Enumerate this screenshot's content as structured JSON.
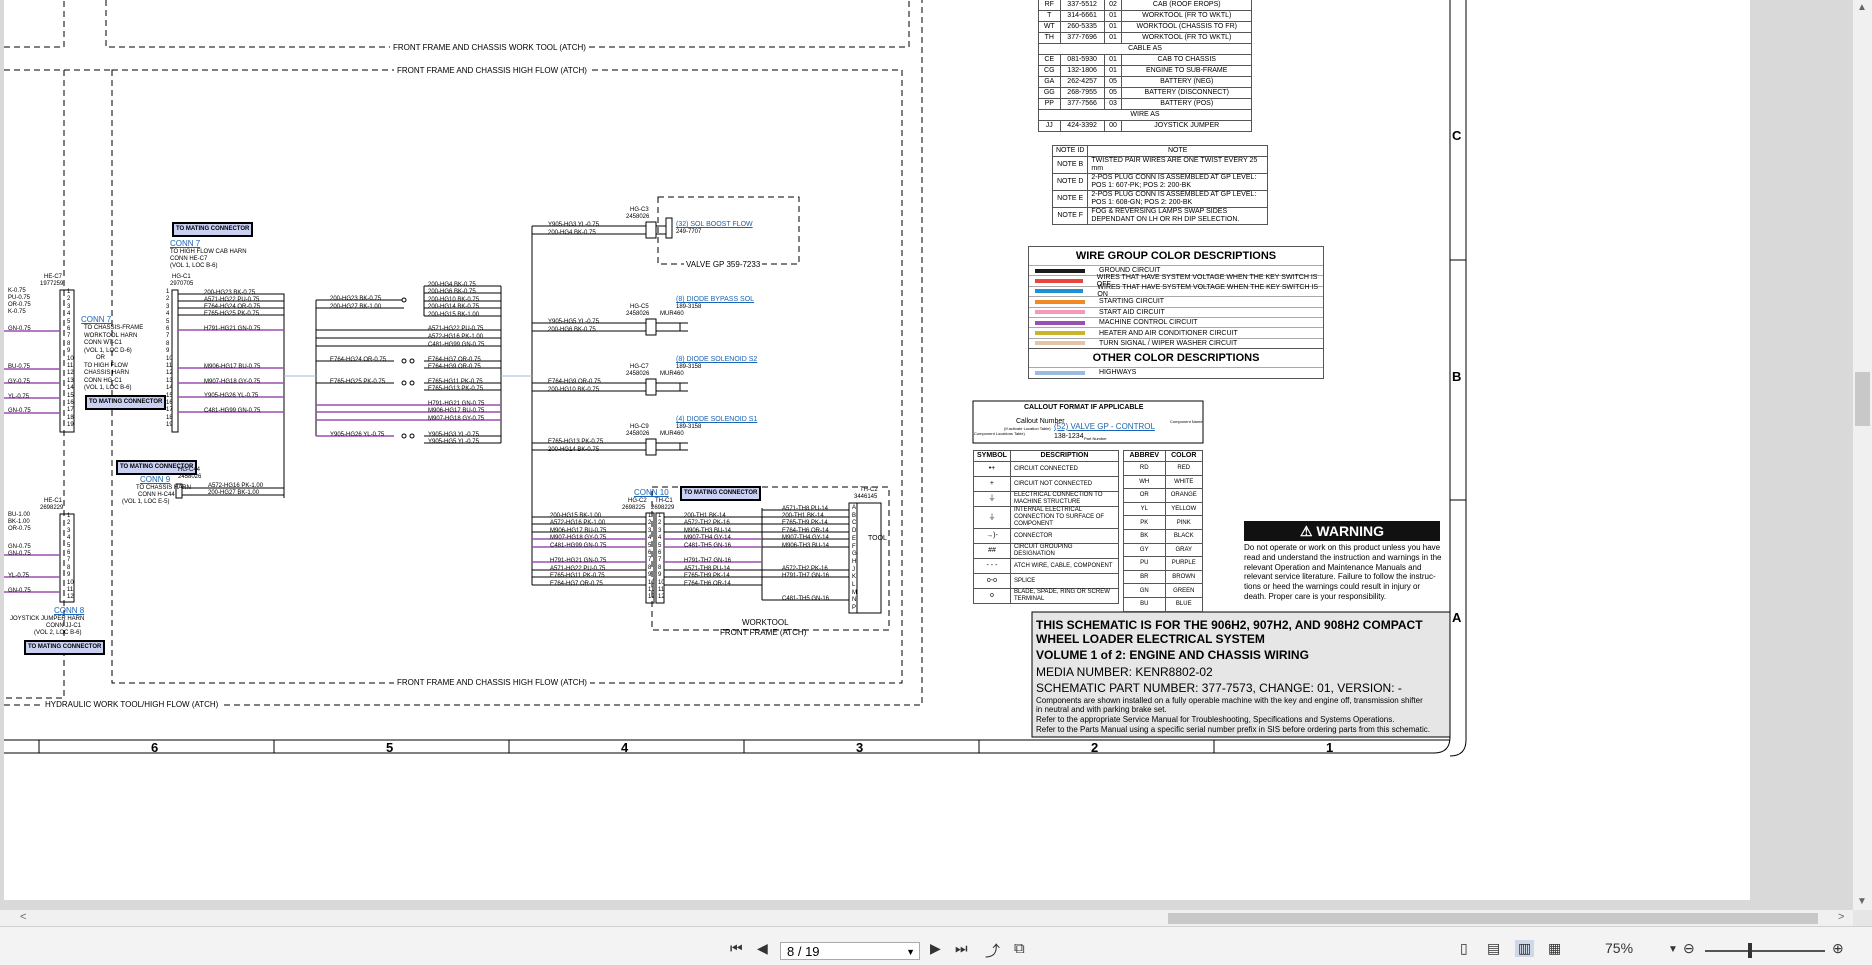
{
  "frames": {
    "work_tool": "FRONT FRAME AND CHASSIS WORK TOOL (ATCH)",
    "high_flow_top": "FRONT FRAME AND CHASSIS HIGH FLOW (ATCH)",
    "high_flow_bottom": "FRONT FRAME AND CHASSIS HIGH FLOW (ATCH)",
    "hydraulic": "HYDRAULIC WORK TOOL/HIGH FLOW (ATCH)"
  },
  "mating": "TO MATING CONNECTOR",
  "conn7a": {
    "title": "CONN 7",
    "l1": "TO HIGH FLOW CAB HARN",
    "l2": "CONN HE-C7",
    "l3": "(VOL 1, LOC B-6)",
    "hg": "HG-C1",
    "pn": "2970705"
  },
  "conn7b": {
    "title": "CONN 7",
    "lines": [
      "TO CHASSIS-FRAME",
      "WORKTOOL HARN",
      "CONN WT-C1",
      "(VOL 1, LOC D-6)",
      "OR",
      "TO HIGH FLOW",
      "CHASSIS HARN",
      "CONN HG-C1",
      "(VOL 1, LOC B-6)"
    ]
  },
  "hec7": {
    "id": "HE-C7",
    "pn": "1977259"
  },
  "hec1": {
    "id": "HE-C1",
    "pn": "2698229"
  },
  "conn9": {
    "title": "CONN 9",
    "l1": "TO CHASSIS HARN",
    "l2": "CONN H-C44",
    "l3": "(VOL 1, LOC E-5)",
    "hg": "HG-C44",
    "pn": "2458026"
  },
  "conn8": {
    "title": "CONN 8",
    "l1": "JOYSTICK JUMPER HARN",
    "l2": "CONN JJ-C1",
    "l3": "(VOL 2, LOC B-6)"
  },
  "conn10": {
    "title": "CONN 10",
    "hgc2": "HG-C2",
    "hgc2pn": "2698225",
    "thc1": "TH-C1",
    "thc1pn": "2698229",
    "thc2": "TH-C2",
    "thc2pn": "3446145",
    "tool": "TOOL",
    "wt1": "WORKTOOL",
    "wt2": "FRONT FRAME (ATCH)"
  },
  "left_wires_top": [
    "K-0.75",
    "PU-0.75",
    "OR-0.75",
    "K-0.75",
    "GN-0.75",
    "BU-0.75",
    "GY-0.75",
    "YL-0.75",
    "GN-0.75"
  ],
  "left_wires_bot": [
    "BU-1.00",
    "BK-1.00",
    "OR-0.75",
    "GN-0.75",
    "GN-0.75",
    "YL-0.75",
    "GN-0.75"
  ],
  "hgc1_wires": [
    "200-HG23 BK-0.75",
    "A571-HG22 PU-0.75",
    "E764-HG24 OR-0.75",
    "E765-HG25 PK-0.75",
    "H791-HG21 GN-0.75",
    "M906-HG17 BU-0.75",
    "M907-HG18 GY-0.75",
    "Y905-HG26 YL-0.75",
    "C481-HG99 GN-0.75"
  ],
  "hgc44_wires": [
    "A572-HG16 PK-1.00",
    "200-HG27 BK-1.00"
  ],
  "splice_in": [
    "200-HG23 BK-0.75",
    "200-HG27 BK-1.00",
    "E764-HG24 OR-0.75",
    "E765-HG25 PK-0.75",
    "Y905-HG26 YL-0.75"
  ],
  "splice_out": [
    "200-HG4 BK-0.75",
    "200-HG6 BK-0.75",
    "200-HG10 BK-0.75",
    "200-HG14 BK-0.75",
    "200-HG15 BK-1.00",
    "A571-HG22 PU-0.75",
    "A572-HG16 PK-1.00",
    "C481-HG99 GN-0.75",
    "E764-HG7 OR-0.75",
    "E764-HG9 OR-0.75",
    "E765-HG11 PK-0.75",
    "E765-HG13 PK-0.75",
    "H791-HG21 GN-0.75",
    "M906-HG17 BU-0.75",
    "M907-HG18 GY-0.75",
    "Y905-HG3 YL-0.75",
    "Y905-HG5 YL-0.75"
  ],
  "components": [
    {
      "id": "HG-C3",
      "pn": "2458026",
      "w1": "Y905-HG3 YL-0.75",
      "w2": "200-HG4 BK-0.75",
      "link": "(32) SOL BOOST FLOW",
      "part": "249-7707"
    },
    {
      "id": "HG-C5",
      "pn": "2458026",
      "w1": "Y905-HG5 YL-0.75",
      "w2": "200-HG6 BK-0.75",
      "link": "(8) DIODE BYPASS SOL",
      "part": "189-3158",
      "extra": "MUR460"
    },
    {
      "id": "HG-C7",
      "pn": "2458026",
      "w1": "E764-HG9 OR-0.75",
      "w2": "200-HG10 BK-0.75",
      "link": "(8) DIODE SOLENOID S2",
      "part": "189-3158",
      "extra": "MUR460"
    },
    {
      "id": "HG-C9",
      "pn": "2458026",
      "w1": "E765-HG13 PK-0.75",
      "w2": "200-HG14 BK-0.75",
      "link": "(4) DIODE SOLENOID S1",
      "part": "189-3158",
      "extra": "MUR460"
    }
  ],
  "valve": "VALVE GP 359-7233",
  "conn10_left": [
    "200-HG15 BK-1.00",
    "A572-HG16 PK-1.00",
    "M906-HG17 BU-0.75",
    "M907-HG18 GY-0.75",
    "C481-HG99 GN-0.75",
    "",
    "H791-HG21 GN-0.75",
    "A571-HG22 PU-0.75",
    "E765-HG11 PK-0.75",
    "E764-HG7 OR-0.75"
  ],
  "conn10_mid": [
    "200-TH1 BK-14",
    "A572-TH2 PK-16",
    "M906-TH3 BU-14",
    "M907-TH4 GY-14",
    "C481-TH5 GN-16",
    "",
    "H791-TH7 GN-16",
    "A571-TH8 PU-14",
    "E765-TH9 PK-14",
    "E764-TH6 OR-14"
  ],
  "conn10_right": [
    "A571-TH8 PU-14",
    "200-TH1 BK-14",
    "E765-TH9 PK-14",
    "E764-TH6 OR-14",
    "M907-TH4 GY-14",
    "M906-TH3 BU-14",
    "",
    "A572-TH2 PK-16",
    "H791-TH7 GN-16",
    "",
    "C481-TH5 GN-16"
  ],
  "tool_pins": [
    "A",
    "B",
    "C",
    "D",
    "E",
    "F",
    "G",
    "H",
    "J",
    "K",
    "L",
    "M",
    "N",
    "P"
  ],
  "harness_rows": [
    [
      "RF",
      "337-5512",
      "02",
      "CAB (ROOF EROPS)"
    ],
    [
      "T",
      "314-6661",
      "01",
      "WORKTOOL (FR TO WKTL)"
    ],
    [
      "WT",
      "260-5335",
      "01",
      "WORKTOOL (CHASSIS TO FR)"
    ],
    [
      "TH",
      "377-7696",
      "01",
      "WORKTOOL (FR TO WKTL)"
    ]
  ],
  "cable_title": "CABLE AS",
  "cable_rows": [
    [
      "CE",
      "081-5930",
      "01",
      "CAB TO CHASSIS"
    ],
    [
      "CG",
      "132-1806",
      "01",
      "ENGINE TO SUB-FRAME"
    ],
    [
      "GA",
      "262-4257",
      "05",
      "BATTERY (NEG)"
    ],
    [
      "GG",
      "268-7955",
      "05",
      "BATTERY (DISCONNECT)"
    ],
    [
      "PP",
      "377-7566",
      "03",
      "BATTERY (POS)"
    ]
  ],
  "wire_title": "WIRE AS",
  "wire_rows": [
    [
      "JJ",
      "424-3392",
      "00",
      "JOYSTICK JUMPER"
    ]
  ],
  "notes": {
    "h1": "NOTE ID",
    "h2": "NOTE",
    "rows": [
      [
        "NOTE B",
        "TWISTED PAIR WIRES ARE ONE TWIST EVERY 25 mm"
      ],
      [
        "NOTE D",
        "2-POS PLUG CONN IS ASSEMBLED AT GP LEVEL:  POS 1: 607-PK; POS 2: 200-BK"
      ],
      [
        "NOTE E",
        "2-POS PLUG CONN IS ASSEMBLED AT GP LEVEL:  POS 1: 608-GN; POS 2: 200-BK"
      ],
      [
        "NOTE F",
        "FOG & REVERSING LAMPS SWAP SIDES DEPENDANT ON LH OR RH DIP SELECTION."
      ]
    ]
  },
  "wire_groups": {
    "title": "WIRE GROUP COLOR DESCRIPTIONS",
    "rows": [
      {
        "color": "#1a1a1a",
        "label": "GROUND CIRCUIT"
      },
      {
        "color": "#e8453c",
        "label": "WIRES THAT HAVE SYSTEM VOLTAGE WHEN THE KEY SWITCH IS OFF"
      },
      {
        "color": "#1f8fd6",
        "label": "WIRES THAT HAVE SYSTEM VOLTAGE WHEN THE KEY SWITCH IS ON"
      },
      {
        "color": "#f08a24",
        "label": "STARTING CIRCUIT"
      },
      {
        "color": "#f29ab8",
        "label": "START AID CIRCUIT"
      },
      {
        "color": "#9b4fb0",
        "label": "MACHINE CONTROL CIRCUIT"
      },
      {
        "color": "#c9b42a",
        "label": "HEATER AND AIR CONDITIONER CIRCUIT"
      },
      {
        "color": "#e3c4a8",
        "label": "TURN SIGNAL / WIPER WASHER CIRCUIT"
      }
    ],
    "other_title": "OTHER COLOR DESCRIPTIONS",
    "other_rows": [
      {
        "color": "#9dbbe0",
        "label": "HIGHWAYS"
      }
    ]
  },
  "callout": {
    "title": "CALLOUT FORMAT IF APPLICABLE",
    "cn": "Callout Number",
    "cn_sub": "(If activate Location Table)",
    "cl_sub": "Component Locations Table)",
    "link": "(52) VALVE GP - CONTROL",
    "part": "138-1234",
    "cname": "Component Name",
    "pnum": "Part Number"
  },
  "symbols": {
    "h1": "SYMBOL",
    "h2": "DESCRIPTION",
    "rows": [
      {
        "sym": "•+",
        "desc": "CIRCUIT CONNECTED"
      },
      {
        "sym": "+",
        "desc": "CIRCUIT NOT CONNECTED"
      },
      {
        "sym": "⏚",
        "desc": "ELECTRICAL CONNECTION TO MACHINE STRUCTURE"
      },
      {
        "sym": "⏚",
        "desc": "INTERNAL ELECTRICAL CONNECTION TO SURFACE OF COMPONENT"
      },
      {
        "sym": "→)-",
        "desc": "CONNECTOR"
      },
      {
        "sym": "##",
        "desc": "CIRCUIT GROUPING DESIGNATION"
      },
      {
        "sym": "- - -",
        "desc": "ATCH WIRE, CABLE, COMPONENT"
      },
      {
        "sym": "o-o",
        "desc": "SPLICE"
      },
      {
        "sym": "o",
        "desc": "BLADE, SPADE, RING OR SCREW TERMINAL"
      }
    ]
  },
  "abbrev": {
    "h1": "ABBREV",
    "h2": "COLOR",
    "rows": [
      [
        "RD",
        "RED"
      ],
      [
        "WH",
        "WHITE"
      ],
      [
        "OR",
        "ORANGE"
      ],
      [
        "YL",
        "YELLOW"
      ],
      [
        "PK",
        "PINK"
      ],
      [
        "BK",
        "BLACK"
      ],
      [
        "GY",
        "GRAY"
      ],
      [
        "PU",
        "PURPLE"
      ],
      [
        "BR",
        "BROWN"
      ],
      [
        "GN",
        "GREEN"
      ],
      [
        "BU",
        "BLUE"
      ]
    ]
  },
  "warning": {
    "title": "WARNING",
    "text": [
      "Do not operate or work on this product unless you have",
      "read and understand the instruction and warnings in the",
      "relevant Operation and Maintenance Manuals and",
      "relevant service literature. Failure to follow the instruc-",
      "tions or heed the warnings could result in injury or",
      "death. Proper care is your responsibility."
    ]
  },
  "title_block": {
    "l1": "THIS SCHEMATIC IS FOR THE 906H2, 907H2, AND 908H2 COMPACT",
    "l2": "WHEEL LOADER ELECTRICAL SYSTEM",
    "l3": "VOLUME 1 of 2: ENGINE AND CHASSIS WIRING",
    "l4": "MEDIA NUMBER: KENR8802-02",
    "l5": "SCHEMATIC PART NUMBER: 377-7573, CHANGE: 01, VERSION: -",
    "l6": "Components are shown installed on a fully operable machine with the key and engine off, transmission shifter",
    "l7": "in neutral and with parking brake set.",
    "l8": "Refer to the appropriate Service Manual for Troubleshooting, Specifications and Systems Operations.",
    "l9": "Refer to the Parts Manual using a specific serial number prefix in SIS before ordering parts from this schematic."
  },
  "grid": {
    "cols": [
      "6",
      "5",
      "4",
      "3",
      "2",
      "1"
    ],
    "rows": [
      "C",
      "B",
      "A"
    ]
  },
  "toolbar": {
    "page": "8 / 19",
    "zoom": "75%"
  }
}
